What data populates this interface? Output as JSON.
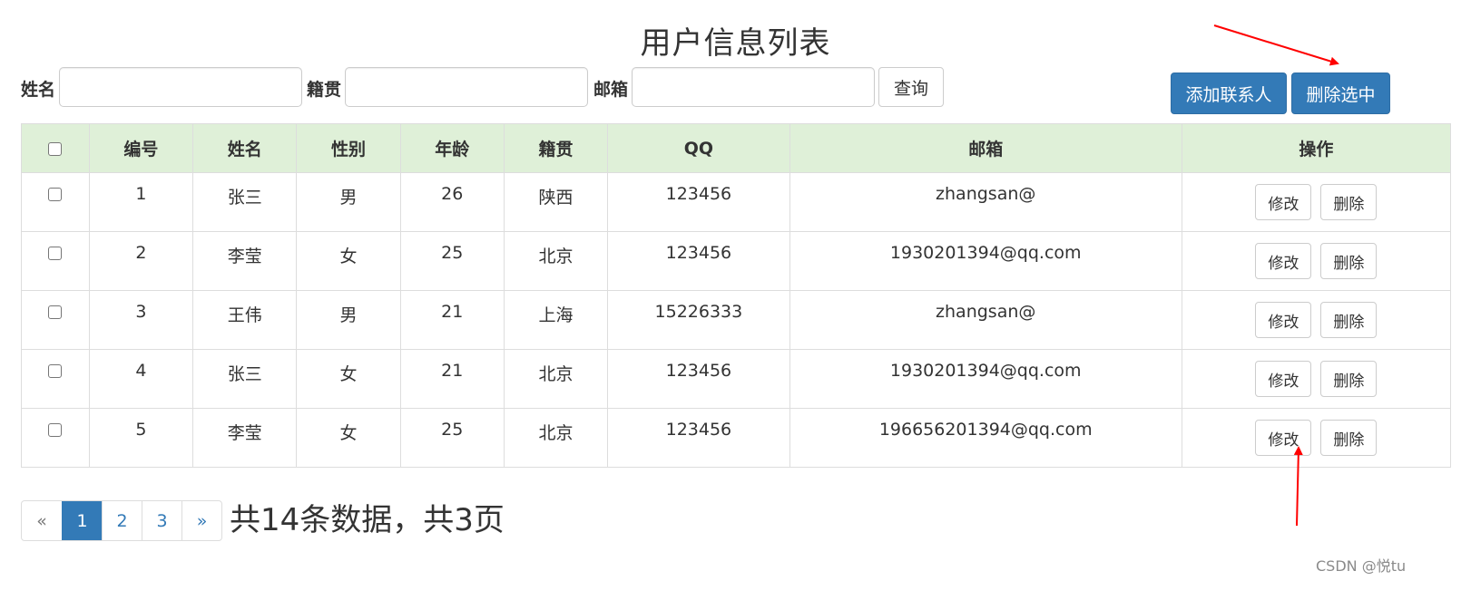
{
  "page": {
    "title": "用户信息列表"
  },
  "search": {
    "name_label": "姓名",
    "name_value": "",
    "hometown_label": "籍贯",
    "hometown_value": "",
    "email_label": "邮箱",
    "email_value": "",
    "query_button": "查询"
  },
  "actions": {
    "add_contact": "添加联系人",
    "delete_selected": "删除选中"
  },
  "table": {
    "headers": [
      "编号",
      "姓名",
      "性别",
      "年龄",
      "籍贯",
      "QQ",
      "邮箱",
      "操作"
    ],
    "rows": [
      {
        "id": "1",
        "name": "张三",
        "gender": "男",
        "age": "26",
        "hometown": "陕西",
        "qq": "123456",
        "email": "zhangsan@"
      },
      {
        "id": "2",
        "name": "李莹",
        "gender": "女",
        "age": "25",
        "hometown": "北京",
        "qq": "123456",
        "email": "1930201394@qq.com"
      },
      {
        "id": "3",
        "name": "王伟",
        "gender": "男",
        "age": "21",
        "hometown": "上海",
        "qq": "15226333",
        "email": "zhangsan@"
      },
      {
        "id": "4",
        "name": "张三",
        "gender": "女",
        "age": "21",
        "hometown": "北京",
        "qq": "123456",
        "email": "1930201394@qq.com"
      },
      {
        "id": "5",
        "name": "李莹",
        "gender": "女",
        "age": "25",
        "hometown": "北京",
        "qq": "123456",
        "email": "196656201394@qq.com"
      }
    ],
    "edit_label": "修改",
    "delete_label": "删除"
  },
  "pagination": {
    "prev": "«",
    "pages": [
      "1",
      "2",
      "3"
    ],
    "active_page": "1",
    "next": "»",
    "summary": "共14条数据，共3页"
  },
  "watermark": "CSDN @悦tu",
  "colors": {
    "primary": "#337ab7",
    "header_bg": "#dff0d8",
    "arrow": "#ff0000"
  }
}
